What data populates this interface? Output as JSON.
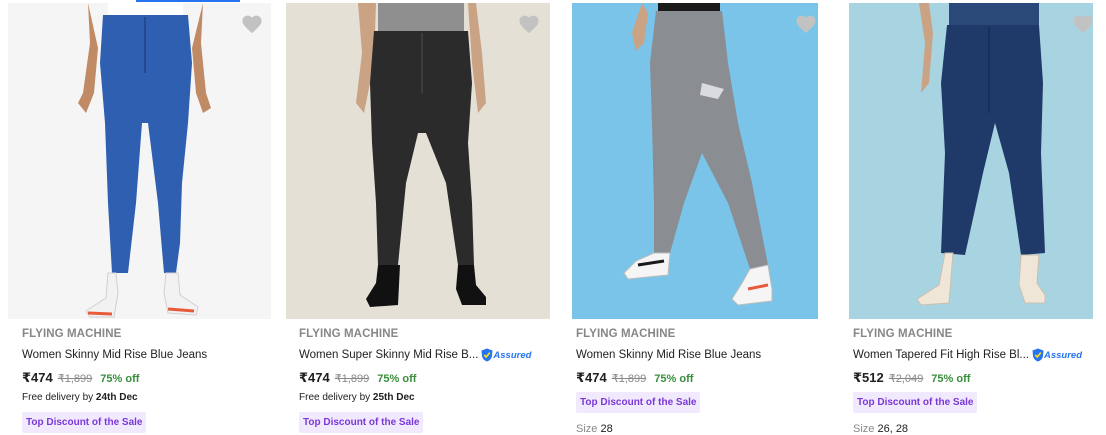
{
  "products": [
    {
      "brand": "FLYING MACHINE",
      "title": "Women Skinny Mid Rise Blue Jeans",
      "price": "₹474",
      "mrp": "₹1,899",
      "discount": "75% off",
      "delivery_prefix": "Free delivery by ",
      "delivery_date": "24th Dec",
      "badge": "Top Discount of the Sale",
      "assured": "",
      "size_label": "",
      "sizes": "",
      "bg_color": "#f5f5f5",
      "jeans_color": "#2f5fb0"
    },
    {
      "brand": "FLYING MACHINE",
      "title": "Women Super Skinny Mid Rise B...",
      "price": "₹474",
      "mrp": "₹1,899",
      "discount": "75% off",
      "delivery_prefix": "Free delivery by ",
      "delivery_date": "25th Dec",
      "badge": "Top Discount of the Sale",
      "assured": "Assured",
      "size_label": "",
      "sizes": "",
      "bg_color": "#e4e0d6",
      "jeans_color": "#2b2b2b"
    },
    {
      "brand": "FLYING MACHINE",
      "title": "Women Skinny Mid Rise Blue Jeans",
      "price": "₹474",
      "mrp": "₹1,899",
      "discount": "75% off",
      "delivery_prefix": "",
      "delivery_date": "",
      "badge": "Top Discount of the Sale",
      "assured": "",
      "size_label": "Size",
      "sizes": "28",
      "bg_color": "#79c4e8",
      "jeans_color": "#8a8d91"
    },
    {
      "brand": "FLYING MACHINE",
      "title": "Women Tapered Fit High Rise Bl...",
      "price": "₹512",
      "mrp": "₹2,049",
      "discount": "75% off",
      "delivery_prefix": "",
      "delivery_date": "",
      "badge": "Top Discount of the Sale",
      "assured": "Assured",
      "size_label": "Size",
      "sizes": "26, 28",
      "bg_color": "#a8d4e2",
      "jeans_color": "#1f3a68"
    }
  ],
  "icons": {
    "wishlist": "heart-icon",
    "assured": "assured-shield-icon"
  },
  "colors": {
    "accent": "#2874f0",
    "discount": "#388e3c",
    "badge_text": "#7b38d8",
    "badge_bg": "#f1eaff"
  }
}
